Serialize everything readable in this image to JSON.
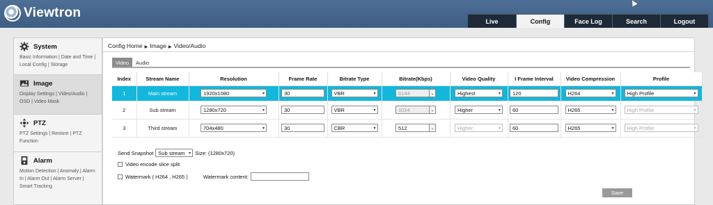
{
  "header": {
    "brand": "Viewtron",
    "nav_tabs": [
      {
        "label": "Live",
        "active": false
      },
      {
        "label": "Config",
        "active": true
      },
      {
        "label": "Face Log",
        "active": false
      },
      {
        "label": "Search",
        "active": false
      },
      {
        "label": "Logout",
        "active": false
      }
    ]
  },
  "sidebar": {
    "sections": [
      {
        "title": "System",
        "icon": "gear-icon",
        "links": "Basic Information | Date and Time | Local Config | Storage"
      },
      {
        "title": "Image",
        "icon": "image-icon",
        "links": "Display Settings | Video/Audio | OSD | Video Mask",
        "active": true
      },
      {
        "title": "PTZ",
        "icon": "ptz-icon",
        "links": "PTZ Settings | Restore | PTZ Function"
      },
      {
        "title": "Alarm",
        "icon": "alarm-icon",
        "links": "Motion Detection | Anomaly | Alarm In | Alarm Out | Alarm Server | Smart Tracking"
      }
    ]
  },
  "breadcrumb": {
    "items": [
      "Config Home",
      "Image",
      "Video/Audio"
    ]
  },
  "subtabs": [
    {
      "label": "Video",
      "active": true
    },
    {
      "label": "Audio",
      "active": false
    }
  ],
  "table": {
    "headers": [
      "Index",
      "Stream Name",
      "Resolution",
      "Frame Rate",
      "Bitrate Type",
      "Bitrate(Kbps)",
      "Video Quality",
      "I Frame Interval",
      "Video Compression",
      "Profile"
    ],
    "rows": [
      {
        "index": "1",
        "name": "Main stream",
        "resolution": "1920x1080",
        "frame_rate": "30",
        "bitrate_type": "VBR",
        "bitrate": "6144",
        "bitrate_disabled": true,
        "quality": "Highest",
        "quality_disabled": false,
        "iframe": "120",
        "compression": "H264",
        "profile": "High Profile",
        "profile_disabled": false,
        "selected": true
      },
      {
        "index": "2",
        "name": "Sub stream",
        "resolution": "1280x720",
        "frame_rate": "30",
        "bitrate_type": "VBR",
        "bitrate": "1024",
        "bitrate_disabled": true,
        "quality": "Higher",
        "quality_disabled": false,
        "iframe": "60",
        "compression": "H265",
        "profile": "High Profile",
        "profile_disabled": true,
        "selected": false
      },
      {
        "index": "3",
        "name": "Third stream",
        "resolution": "704x480",
        "frame_rate": "30",
        "bitrate_type": "CBR",
        "bitrate": "512",
        "bitrate_disabled": false,
        "quality": "Higher",
        "quality_disabled": true,
        "iframe": "60",
        "compression": "H265",
        "profile": "High Profile",
        "profile_disabled": true,
        "selected": false
      }
    ]
  },
  "snapshot": {
    "label": "Send Snapshot",
    "value": "Sub stream",
    "size_text": "Size: (1280x720)"
  },
  "options": {
    "slice_split_label": "Video encode slice split",
    "watermark_label": "Watermark ( H264 , H265 )",
    "watermark_content_label": "Watermark content:",
    "watermark_content_value": ""
  },
  "save_label": "Save",
  "colors": {
    "header_bg": "#4e6f96",
    "selected_row": "#13b7dc",
    "nav_tab_bg": "#1f2a38"
  }
}
